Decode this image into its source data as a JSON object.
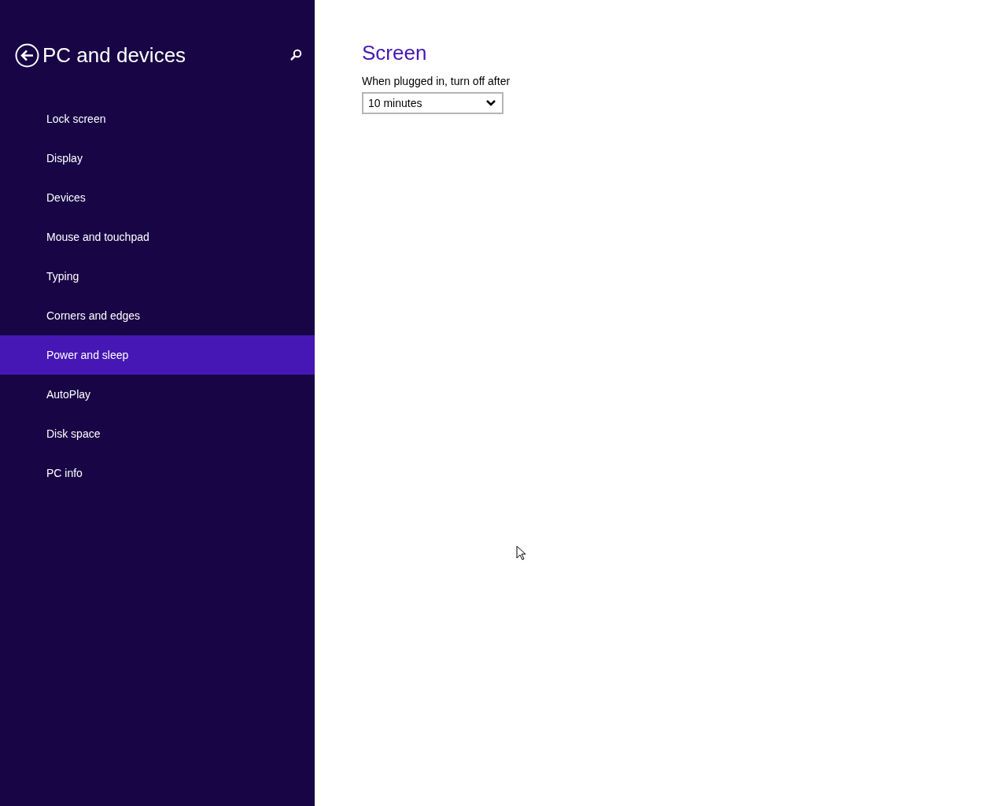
{
  "sidebar": {
    "title": "PC and devices",
    "items": [
      {
        "label": "Lock screen",
        "selected": false
      },
      {
        "label": "Display",
        "selected": false
      },
      {
        "label": "Devices",
        "selected": false
      },
      {
        "label": "Mouse and touchpad",
        "selected": false
      },
      {
        "label": "Typing",
        "selected": false
      },
      {
        "label": "Corners and edges",
        "selected": false
      },
      {
        "label": "Power and sleep",
        "selected": true
      },
      {
        "label": "AutoPlay",
        "selected": false
      },
      {
        "label": "Disk space",
        "selected": false
      },
      {
        "label": "PC info",
        "selected": false
      }
    ]
  },
  "content": {
    "heading": "Screen",
    "setting_label": "When plugged in, turn off after",
    "dropdown": {
      "value": "10 minutes"
    }
  }
}
